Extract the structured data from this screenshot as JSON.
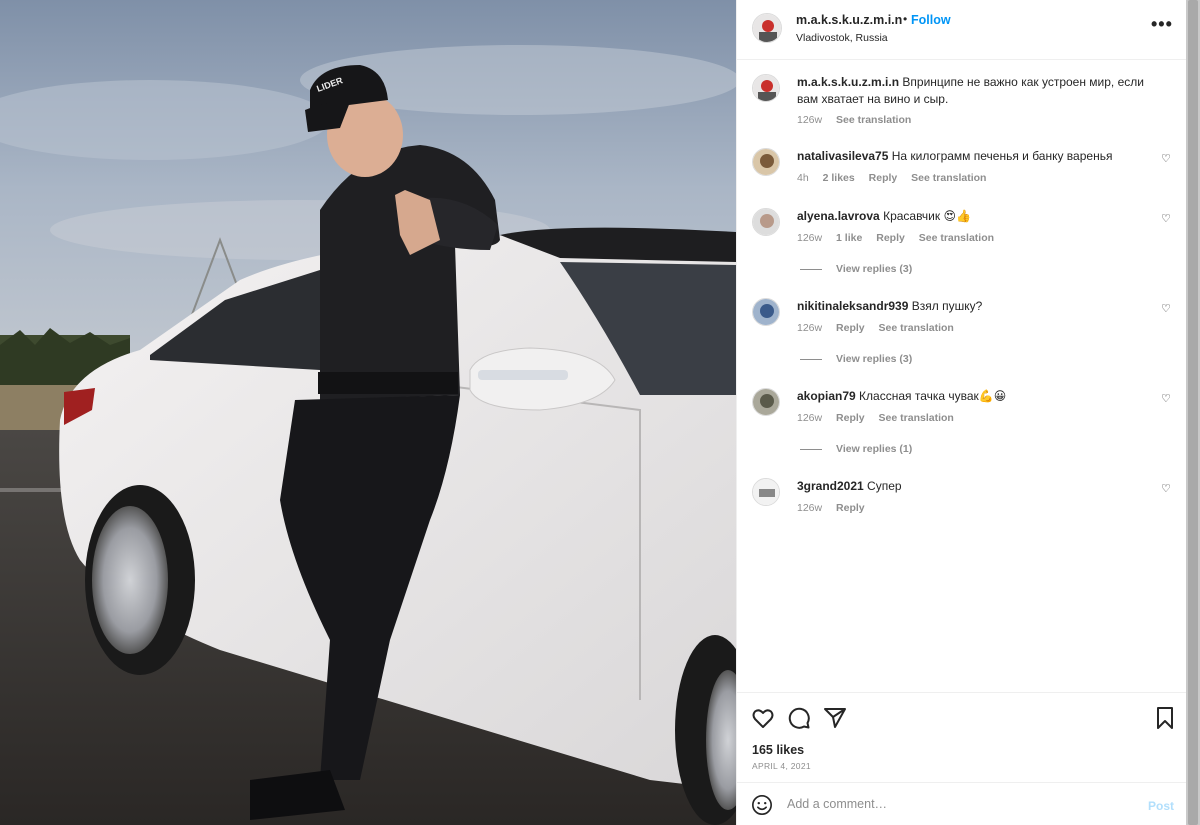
{
  "post": {
    "username": "m.a.k.s.k.u.z.m.i.n",
    "separator": "•",
    "follow_label": "Follow",
    "location": "Vladivostok, Russia",
    "more_label": "•••",
    "photo_cap_text": "LIDER"
  },
  "comments": [
    {
      "user": "m.a.k.s.k.u.z.m.i.n",
      "text": "Впринципе не важно как устроен мир, если вам хватает на вино и сыр.",
      "time": "126w",
      "likes": "",
      "reply": "",
      "see_translation": "See translation",
      "view_replies": "",
      "avatar_color": "#c9302c"
    },
    {
      "user": "natalivasileva75",
      "text": "На килограмм печенья и банку варенья",
      "time": "4h",
      "likes": "2 likes",
      "reply": "Reply",
      "see_translation": "See translation",
      "view_replies": "",
      "avatar_color": "#7a5a3a"
    },
    {
      "user": "alyena.lavrova",
      "text": "Красавчик 😍👍",
      "time": "126w",
      "likes": "1 like",
      "reply": "Reply",
      "see_translation": "See translation",
      "view_replies": "View replies (3)",
      "avatar_color": "#b89a8a"
    },
    {
      "user": "nikitinaleksandr939",
      "text": "Взял пушку?",
      "time": "126w",
      "likes": "",
      "reply": "Reply",
      "see_translation": "See translation",
      "view_replies": "View replies (3)",
      "avatar_color": "#3a5a8a"
    },
    {
      "user": "akopian79",
      "text": "Классная тачка чувак💪😀",
      "time": "126w",
      "likes": "",
      "reply": "Reply",
      "see_translation": "See translation",
      "view_replies": "View replies (1)",
      "avatar_color": "#5a5a4a"
    },
    {
      "user": "3grand2021",
      "text": "Супер",
      "time": "126w",
      "likes": "",
      "reply": "Reply",
      "see_translation": "",
      "view_replies": "",
      "avatar_color": "#d8d8d8"
    }
  ],
  "icons": {
    "like": "heart-icon",
    "comment": "comment-icon",
    "share": "paper-plane-icon",
    "save": "bookmark-icon",
    "emoji": "smiley-icon"
  },
  "stats": {
    "likes": "165 likes",
    "date": "APRIL 4, 2021"
  },
  "add_comment": {
    "placeholder": "Add a comment…",
    "post_label": "Post"
  }
}
